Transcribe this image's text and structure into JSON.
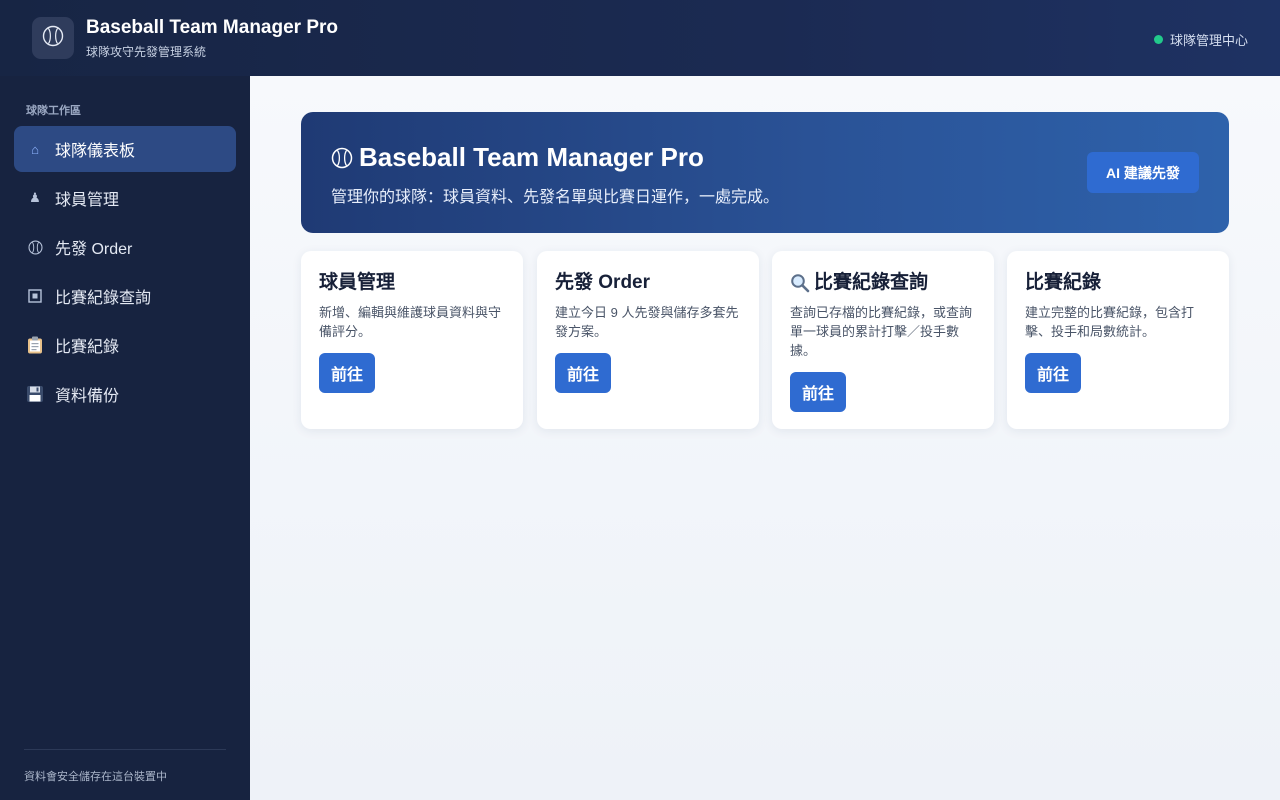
{
  "header": {
    "title": "Baseball Team Manager Pro",
    "subtitle": "球隊攻守先發管理系統",
    "status_label": "球隊管理中心",
    "logo_icon": "baseball-icon"
  },
  "sidebar": {
    "section_label": "球隊工作區",
    "items": [
      {
        "label": "球隊儀表板",
        "icon": "home-icon"
      },
      {
        "label": "球員管理",
        "icon": "player-icon"
      },
      {
        "label": "先發 Order",
        "icon": "baseball-icon"
      },
      {
        "label": "比賽紀錄查詢",
        "icon": "record-icon"
      },
      {
        "label": "比賽紀錄",
        "icon": "clipboard-icon"
      },
      {
        "label": "資料備份",
        "icon": "floppy-disk-icon"
      }
    ],
    "footer": "資料會安全儲存在這台裝置中"
  },
  "hero": {
    "title": "Baseball Team Manager Pro",
    "subtitle": "管理你的球隊：球員資料、先發名單與比賽日運作，一處完成。",
    "ai_button": "AI 建議先發"
  },
  "cards": [
    {
      "title": "球員管理",
      "desc": "新增、編輯與維護球員資料與守備評分。",
      "button": "前往"
    },
    {
      "title": "先發 Order",
      "desc": "建立今日 9 人先發與儲存多套先發方案。",
      "button": "前往"
    },
    {
      "title": "比賽紀錄查詢",
      "desc": "查詢已存檔的比賽紀錄，或查詢單一球員的累計打擊／投手數據。",
      "button": "前往",
      "icon": "search-icon"
    },
    {
      "title": "比賽紀錄",
      "desc": "建立完整的比賽紀錄，包含打擊、投手和局數統計。",
      "button": "前往"
    }
  ],
  "colors": {
    "accent": "#2f6bd1",
    "status": "#22c98b",
    "sidebar": "#172340"
  }
}
